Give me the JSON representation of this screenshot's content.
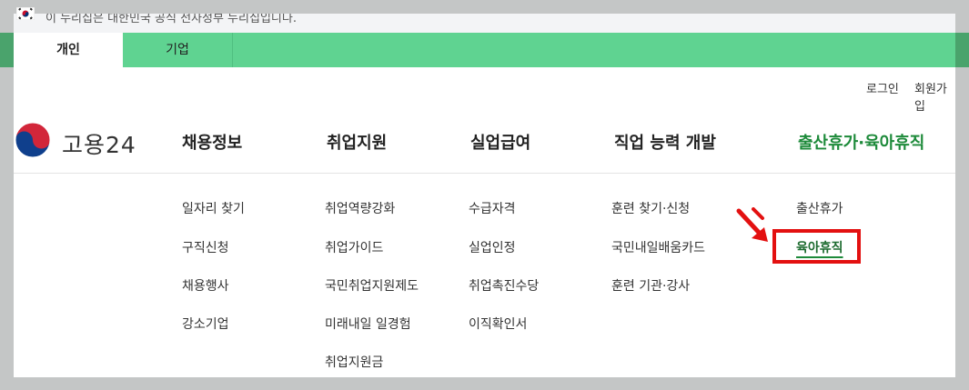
{
  "gov_notice": "이 누리집은 대한민국 공식 전자정부 누리집입니다.",
  "tabs": [
    {
      "label": "개인",
      "active": true
    },
    {
      "label": "기업",
      "active": false
    }
  ],
  "util_links": {
    "login": "로그인",
    "signup": "회원가입"
  },
  "logo_text": "고용24",
  "menu": [
    {
      "label": "채용정보",
      "items": [
        "일자리 찾기",
        "구직신청",
        "채용행사",
        "강소기업"
      ]
    },
    {
      "label": "취업지원",
      "items": [
        "취업역량강화",
        "취업가이드",
        "국민취업지원제도",
        "미래내일 일경험",
        "취업지원금"
      ]
    },
    {
      "label": "실업급여",
      "items": [
        "수급자격",
        "실업인정",
        "취업촉진수당",
        "이직확인서"
      ]
    },
    {
      "label": "직업 능력 개발",
      "items": [
        "훈련 찾기·신청",
        "국민내일배움카드",
        "훈련 기관·강사"
      ]
    },
    {
      "label": "출산휴가·육아휴직",
      "active": true,
      "items": [
        "출산휴가",
        "육아휴직"
      ],
      "highlighted_item": "육아휴직"
    }
  ],
  "colors": {
    "tab_green": "#5fd391",
    "active_menu": "#1d8a3a",
    "highlight_red": "#e31010"
  }
}
